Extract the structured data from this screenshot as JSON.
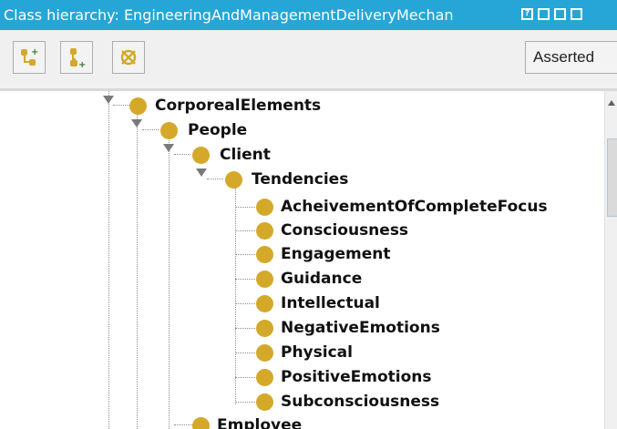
{
  "window": {
    "title": "Class hierarchy: EngineeringAndManagementDeliveryMechan",
    "controls": [
      "?",
      "▮▮",
      "▬",
      "■"
    ]
  },
  "toolbar": {
    "buttons": [
      {
        "icon": "add-subclass-icon"
      },
      {
        "icon": "add-sibling-class-icon"
      },
      {
        "icon": "delete-class-icon"
      }
    ],
    "view_mode": "Asserted"
  },
  "tree": {
    "nodes": [
      {
        "label": "CorporealElements",
        "expanded": true
      },
      {
        "label": "People",
        "expanded": true
      },
      {
        "label": "Client",
        "expanded": true
      },
      {
        "label": "Tendencies",
        "expanded": true
      },
      {
        "label": "AcheivementOfCompleteFocus"
      },
      {
        "label": "Consciousness"
      },
      {
        "label": "Engagement"
      },
      {
        "label": "Guidance"
      },
      {
        "label": "Intellectual"
      },
      {
        "label": "NegativeEmotions"
      },
      {
        "label": "Physical"
      },
      {
        "label": "PositiveEmotions"
      },
      {
        "label": "Subconsciousness"
      },
      {
        "label": "Employee"
      }
    ]
  },
  "colors": {
    "title_bar": "#25a6d6",
    "class_ball": "#d4a92a"
  }
}
